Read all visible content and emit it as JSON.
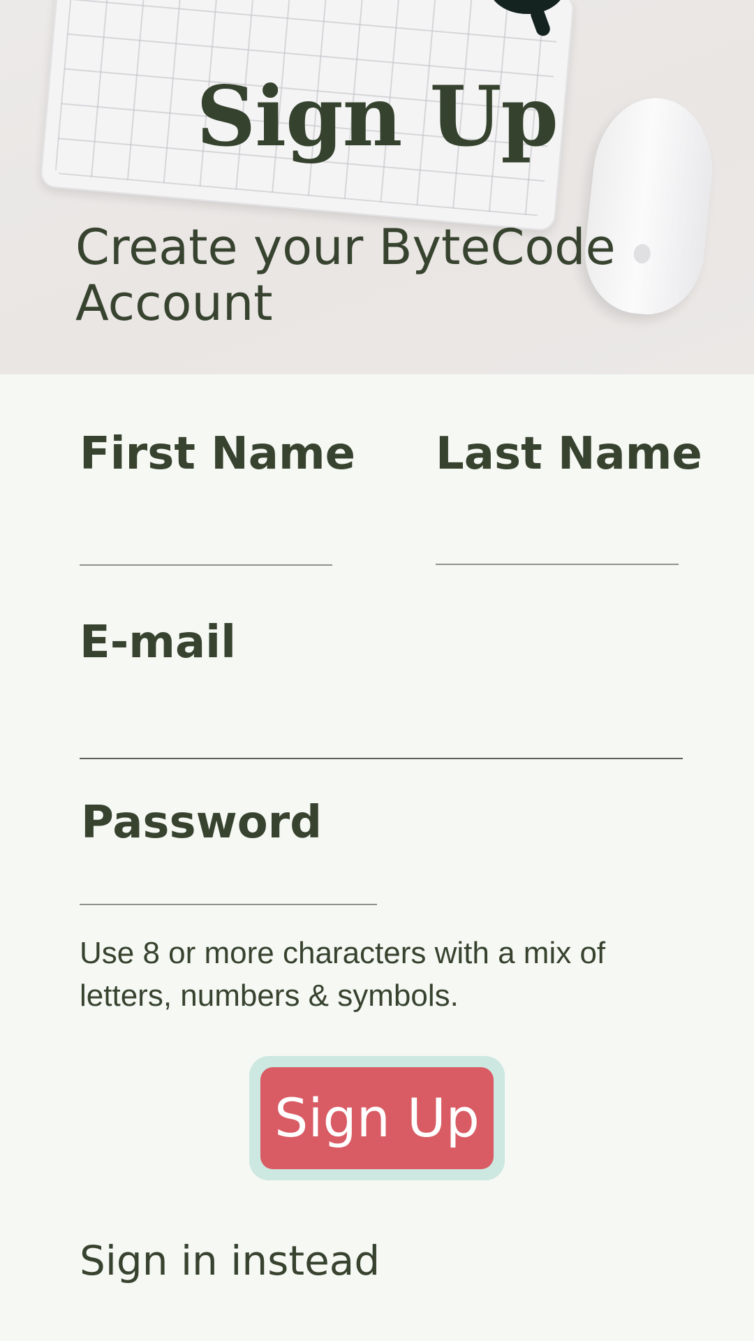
{
  "hero": {
    "title": "Sign Up",
    "subtitle": "Create your ByteCode Account"
  },
  "form": {
    "first_name": {
      "label": "First Name",
      "value": ""
    },
    "last_name": {
      "label": "Last Name",
      "value": ""
    },
    "email": {
      "label": "E-mail",
      "value": ""
    },
    "password": {
      "label": "Password",
      "value": ""
    },
    "password_hint": "Use 8 or more characters with a mix of letters, numbers & symbols."
  },
  "actions": {
    "signup_label": "Sign Up",
    "signin_label": "Sign in instead"
  },
  "colors": {
    "background": "#f6f8f4",
    "text": "#37432f",
    "button": "#d95b64",
    "button_outline": "#cde7e1"
  }
}
